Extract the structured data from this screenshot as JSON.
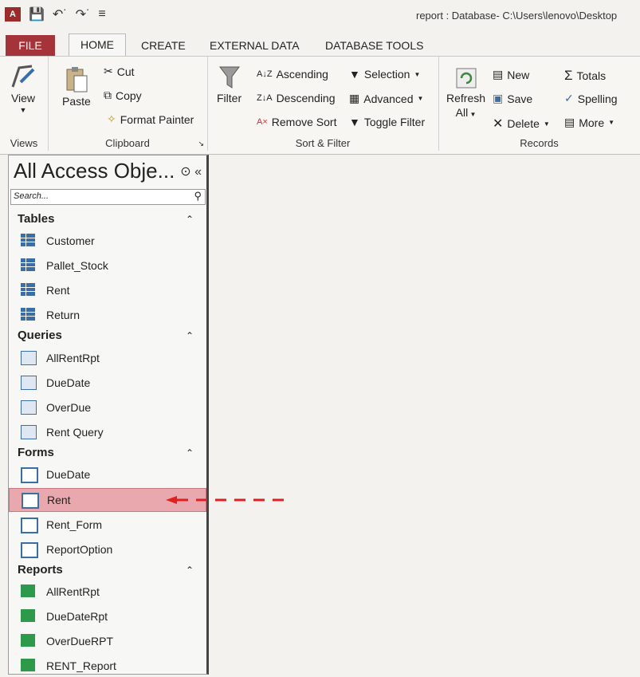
{
  "app": {
    "logo": "A",
    "window_title": "report : Database- C:\\Users\\lenovo\\Desktop"
  },
  "tabs": [
    "FILE",
    "HOME",
    "CREATE",
    "EXTERNAL DATA",
    "DATABASE TOOLS"
  ],
  "ribbon": {
    "views": {
      "view_label": "View",
      "group_label": "Views"
    },
    "clipboard": {
      "paste": "Paste",
      "cut": "Cut",
      "copy": "Copy",
      "format_painter": "Format Painter",
      "group_label": "Clipboard"
    },
    "sort_filter": {
      "filter": "Filter",
      "ascending": "Ascending",
      "descending": "Descending",
      "remove_sort": "Remove Sort",
      "selection": "Selection",
      "advanced": "Advanced",
      "toggle_filter": "Toggle Filter",
      "group_label": "Sort & Filter"
    },
    "records": {
      "refresh": "Refresh",
      "refresh_all": "All",
      "new": "New",
      "save": "Save",
      "delete": "Delete",
      "totals": "Totals",
      "spelling": "Spelling",
      "more": "More",
      "group_label": "Records"
    }
  },
  "nav": {
    "title": "All Access Obje...",
    "search_placeholder": "Search...",
    "sections": [
      {
        "label": "Tables",
        "items": [
          "Customer",
          "Pallet_Stock",
          "Rent",
          "Return"
        ]
      },
      {
        "label": "Queries",
        "items": [
          "AllRentRpt",
          "DueDate",
          "OverDue",
          "Rent Query"
        ]
      },
      {
        "label": "Forms",
        "items": [
          "DueDate",
          "Rent",
          "Rent_Form",
          "ReportOption"
        ]
      },
      {
        "label": "Reports",
        "items": [
          "AllRentRpt",
          "DueDateRpt",
          "OverDueRPT",
          "RENT_Report"
        ]
      }
    ],
    "selected": "Forms/Rent"
  },
  "colors": {
    "file_tab": "#a4333a",
    "selected_row": "#e8a8ae",
    "arrow": "#e02020"
  }
}
